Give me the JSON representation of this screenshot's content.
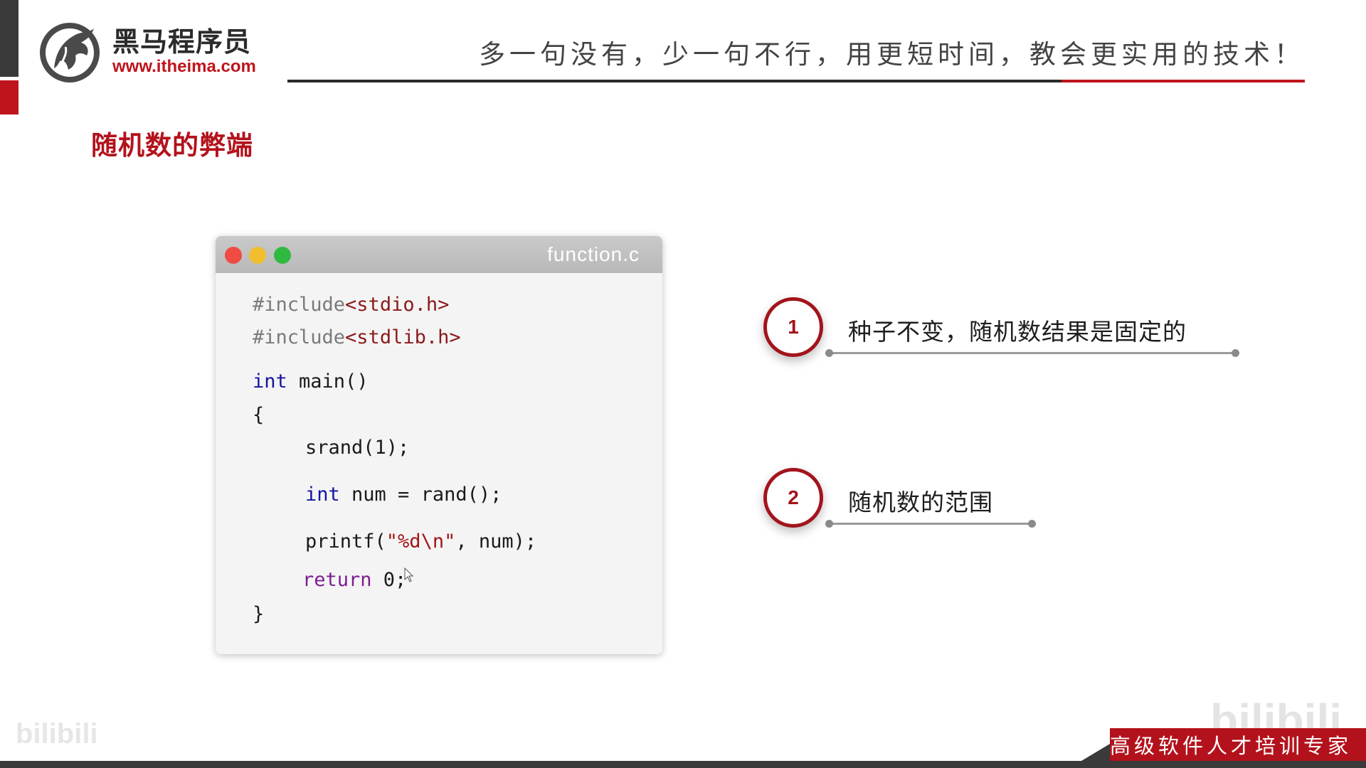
{
  "header": {
    "logo_name": "黑马程序员",
    "logo_url": "www.itheima.com",
    "slogan": "多一句没有，少一句不行，用更短时间，教会更实用的技术！"
  },
  "slide": {
    "title": "随机数的弊端"
  },
  "code_window": {
    "filename": "function.c",
    "lines": {
      "l1_kw": "#include",
      "l1_hdr": "<stdio.h>",
      "l2_kw": "#include",
      "l2_hdr": "<stdlib.h>",
      "l3_type": "int",
      "l3_rest": " main()",
      "l4": "{",
      "l5": "srand(1);",
      "l6_type": "int",
      "l6_rest": " num = rand();",
      "l7_a": "printf(",
      "l7_str": "\"%d\\n\"",
      "l7_b": ", num);",
      "l8_kw": "return",
      "l8_rest": " 0;",
      "l9": "}"
    }
  },
  "points": [
    {
      "number": "1",
      "text": "种子不变，随机数结果是固定的"
    },
    {
      "number": "2",
      "text": "随机数的范围"
    }
  ],
  "footer": {
    "tagline": "高级软件人才培训专家",
    "watermark_left": "bilibili",
    "watermark_right": "bilibili"
  },
  "colors": {
    "brand_red": "#c0141c",
    "dark_bar": "#3a3a3a"
  }
}
